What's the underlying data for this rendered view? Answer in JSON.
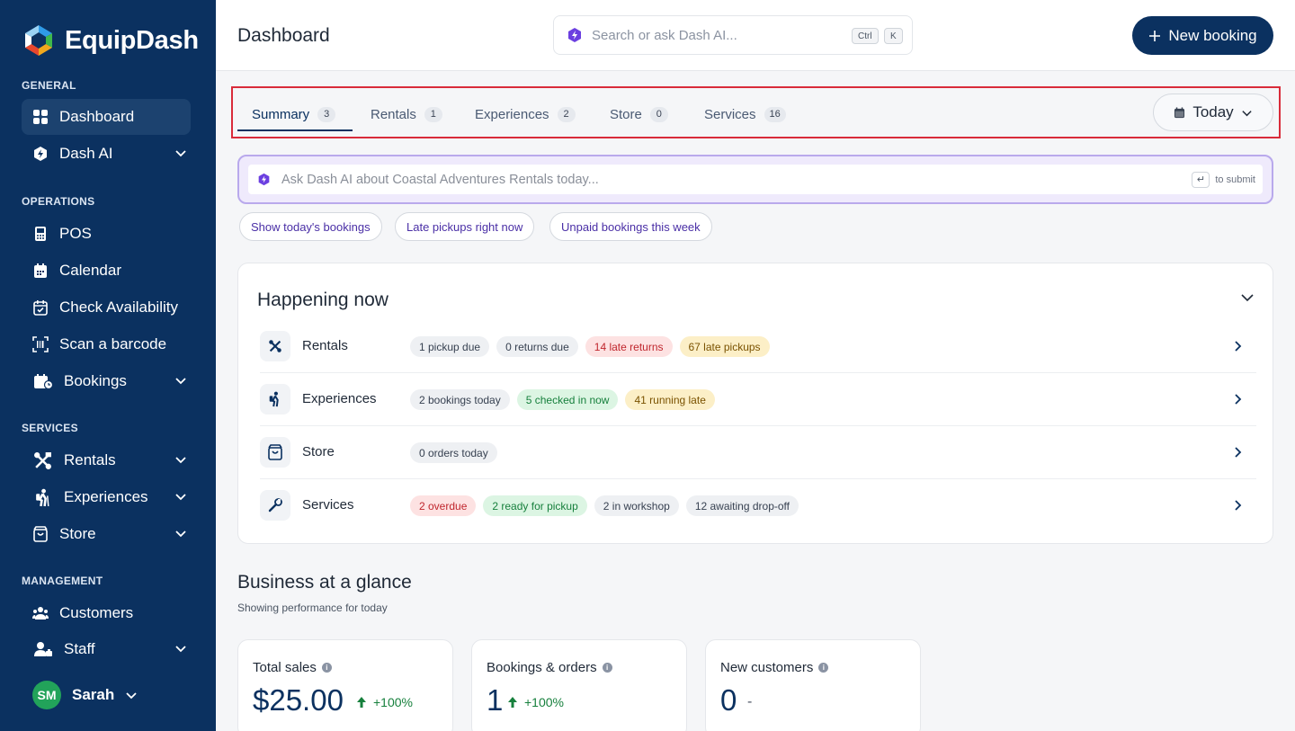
{
  "app": {
    "name": "EquipDash"
  },
  "sidebar": {
    "sections": {
      "general": "GENERAL",
      "operations": "OPERATIONS",
      "services": "SERVICES",
      "management": "MANAGEMENT"
    },
    "items": {
      "dashboard": "Dashboard",
      "dash_ai": "Dash AI",
      "pos": "POS",
      "calendar": "Calendar",
      "check_availability": "Check Availability",
      "scan_barcode": "Scan a barcode",
      "bookings": "Bookings",
      "rentals": "Rentals",
      "experiences": "Experiences",
      "store": "Store",
      "customers": "Customers",
      "staff": "Staff"
    },
    "user": {
      "initials": "SM",
      "name": "Sarah"
    }
  },
  "header": {
    "title": "Dashboard",
    "search_placeholder": "Search or ask Dash AI...",
    "kbd_ctrl": "Ctrl",
    "kbd_k": "K",
    "new_booking": "New booking"
  },
  "tabs": [
    {
      "label": "Summary",
      "count": "3"
    },
    {
      "label": "Rentals",
      "count": "1"
    },
    {
      "label": "Experiences",
      "count": "2"
    },
    {
      "label": "Store",
      "count": "0"
    },
    {
      "label": "Services",
      "count": "16"
    }
  ],
  "date_filter": "Today",
  "ask": {
    "placeholder": "Ask Dash AI about Coastal Adventures Rentals today...",
    "enter_glyph": "↵",
    "submit_hint": "to submit",
    "chips": [
      "Show today's bookings",
      "Late pickups right now",
      "Unpaid bookings this week"
    ]
  },
  "happening": {
    "title": "Happening now",
    "rows": [
      {
        "label": "Rentals",
        "pills": [
          {
            "text": "1 pickup due",
            "tone": "gray"
          },
          {
            "text": "0 returns due",
            "tone": "gray"
          },
          {
            "text": "14 late returns",
            "tone": "red"
          },
          {
            "text": "67 late pickups",
            "tone": "yellow"
          }
        ]
      },
      {
        "label": "Experiences",
        "pills": [
          {
            "text": "2 bookings today",
            "tone": "gray"
          },
          {
            "text": "5 checked in now",
            "tone": "green"
          },
          {
            "text": "41 running late",
            "tone": "yellow"
          }
        ]
      },
      {
        "label": "Store",
        "pills": [
          {
            "text": "0 orders today",
            "tone": "gray"
          }
        ]
      },
      {
        "label": "Services",
        "pills": [
          {
            "text": "2 overdue",
            "tone": "red"
          },
          {
            "text": "2 ready for pickup",
            "tone": "green"
          },
          {
            "text": "2 in workshop",
            "tone": "gray"
          },
          {
            "text": "12 awaiting drop-off",
            "tone": "gray"
          }
        ]
      }
    ]
  },
  "business": {
    "title": "Business at a glance",
    "subtitle": "Showing performance for today",
    "stats": [
      {
        "label": "Total sales",
        "value": "$25.00",
        "trend": "+100%"
      },
      {
        "label": "Bookings & orders",
        "value": "1",
        "trend": "+100%"
      },
      {
        "label": "New customers",
        "value": "0",
        "trend": "-"
      }
    ]
  },
  "colors": {
    "sidebar_bg": "#0b3160",
    "accent_purple": "#6b3fe0",
    "highlight_border": "#d92b3a",
    "positive": "#17803d"
  }
}
